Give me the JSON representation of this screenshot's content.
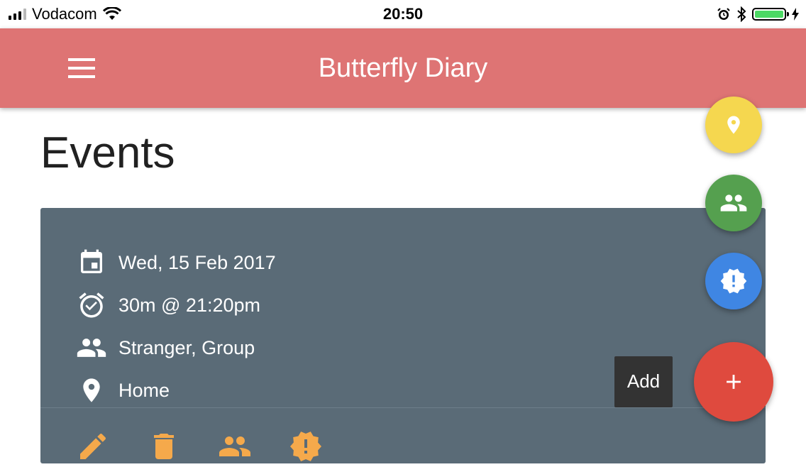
{
  "status_bar": {
    "carrier": "Vodacom",
    "time": "20:50",
    "battery_level": 1.0
  },
  "app_bar": {
    "title": "Butterfly Diary",
    "menu_icon": "hamburger-menu-icon",
    "color": "#de7474"
  },
  "page": {
    "title": "Events"
  },
  "event": {
    "date": "Wed, 15 Feb 2017",
    "duration_time": "30m @ 21:20pm",
    "people": "Stranger, Group",
    "location": "Home",
    "icons": [
      "calendar-icon",
      "alarm-check-icon",
      "people-icon",
      "location-pin-icon"
    ],
    "card_color": "#5a6b77",
    "actions": [
      "edit-pencil-icon",
      "delete-trash-icon",
      "people-icon",
      "alert-badge-icon"
    ],
    "action_color": "#f5a94b"
  },
  "fabs": {
    "location": {
      "icon": "location-pin-icon",
      "color": "#f5d74f"
    },
    "people": {
      "icon": "people-icon",
      "color": "#55a04f"
    },
    "alert": {
      "icon": "alert-badge-icon",
      "color": "#3f86e3"
    },
    "add": {
      "icon": "plus-icon",
      "color": "#df4a3e",
      "tooltip": "Add"
    }
  }
}
